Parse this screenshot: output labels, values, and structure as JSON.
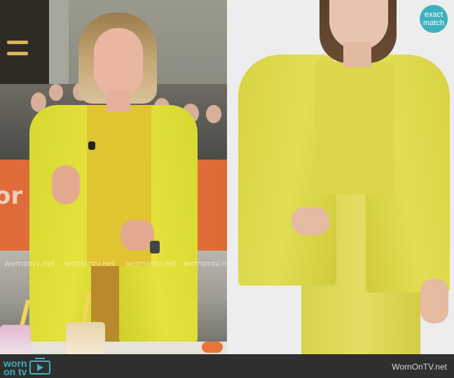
{
  "left_panel": {
    "banner_text": "or",
    "watermark_lines": [
      "wornontv.net",
      "wornontv.net",
      "wornontv.net",
      "wornontv.net"
    ]
  },
  "right_panel": {
    "badge": {
      "line1": "exact",
      "line2": "match",
      "color": "#3fb0bd"
    }
  },
  "footer": {
    "logo_word_top": "worn",
    "logo_word_bottom": "on tv",
    "logo_icon": "tv-play-icon",
    "site": "WornOnTV.net",
    "background": "#2f2f2f",
    "accent": "#3fb0bd"
  }
}
